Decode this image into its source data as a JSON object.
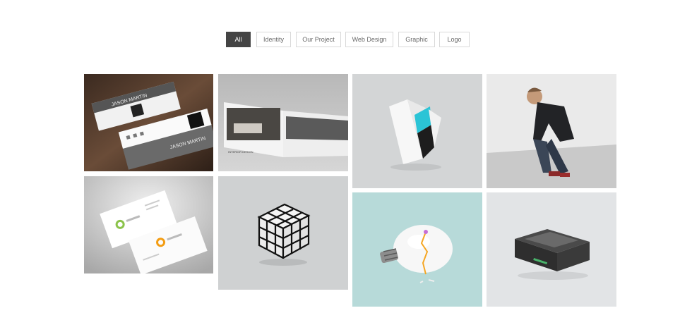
{
  "filters": [
    {
      "label": "All",
      "active": true
    },
    {
      "label": "Identity",
      "active": false
    },
    {
      "label": "Our Project",
      "active": false
    },
    {
      "label": "Web Design",
      "active": false
    },
    {
      "label": "Graphic",
      "active": false
    },
    {
      "label": "Logo",
      "active": false
    }
  ],
  "portfolio": {
    "items": [
      {
        "name": "business-card-qr",
        "card_name": "JASON MARTIN"
      },
      {
        "name": "brochure-mockup",
        "cover_text": "INTERIOR DESIGN"
      },
      {
        "name": "trifold-mockup"
      },
      {
        "name": "model-photo"
      },
      {
        "name": "business-card-white"
      },
      {
        "name": "cube-puzzle"
      },
      {
        "name": "egg-bulb"
      },
      {
        "name": "hard-drive"
      }
    ]
  },
  "colors": {
    "active_filter_bg": "#444444",
    "filter_border": "#d9d9d9",
    "accent_teal": "#2bc4d6"
  }
}
